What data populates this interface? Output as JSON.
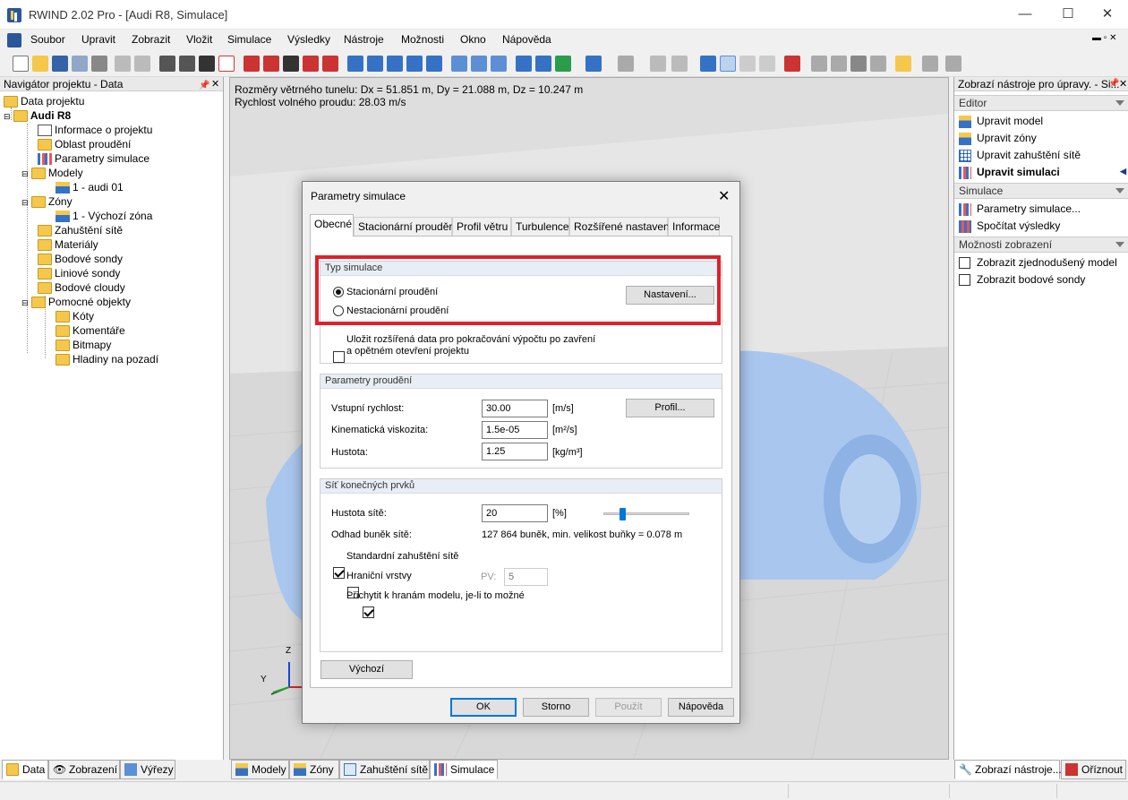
{
  "window": {
    "title": "RWIND 2.02 Pro - [Audi R8, Simulace]"
  },
  "menu": [
    "Soubor",
    "Upravit",
    "Zobrazit",
    "Vložit",
    "Simulace",
    "Výsledky",
    "Nástroje",
    "Možnosti",
    "Okno",
    "Nápověda"
  ],
  "navigator": {
    "title": "Navigátor projektu - Data",
    "items": [
      "Data projektu",
      "Audi R8",
      "Informace o projektu",
      "Oblast proudění",
      "Parametry simulace",
      "Modely",
      "1 - audi 01",
      "Zóny",
      "1 - Výchozí zóna",
      "Zahuštění sítě",
      "Materiály",
      "Bodové sondy",
      "Liniové sondy",
      "Bodové cloudy",
      "Pomocné objekty",
      "Kóty",
      "Komentáře",
      "Bitmapy",
      "Hladiny na pozadí"
    ]
  },
  "viewport": {
    "line1": "Rozměry větrného tunelu: Dx = 51.851 m, Dy = 21.088 m, Dz = 10.247 m",
    "line2": "Rychlost volného proudu: 28.03 m/s",
    "axis_z": "Z",
    "axis_y": "Y"
  },
  "right_panel": {
    "title": "Zobrazí nástroje pro úpravy. - Si...",
    "editor_head": "Editor",
    "editor_items": [
      "Upravit model",
      "Upravit zóny",
      "Upravit zahuštění sítě",
      "Upravit simulaci"
    ],
    "sim_head": "Simulace",
    "sim_items": [
      "Parametry simulace...",
      "Spočítat výsledky"
    ],
    "display_head": "Možnosti zobrazení",
    "display_items": [
      "Zobrazit zjednodušený model",
      "Zobrazit bodové sondy"
    ]
  },
  "bottom_tabs_left": [
    "Data",
    "Zobrazení",
    "Výřezy"
  ],
  "bottom_tabs_mid": [
    "Modely",
    "Zóny",
    "Zahuštění sítě",
    "Simulace"
  ],
  "bottom_tabs_right": [
    "Zobrazí nástroje...",
    "Oříznout"
  ],
  "dialog": {
    "title": "Parametry simulace",
    "close": "✕",
    "tabs": [
      "Obecné",
      "Stacionární proudění",
      "Profil větru",
      "Turbulence",
      "Rozšířené nastavení",
      "Informace"
    ],
    "type_group": "Typ simulace",
    "radio_stationary": "Stacionární proudění",
    "radio_nonstationary": "Nestacionární proudění",
    "settings_button": "Nastavení...",
    "save_extended_1": "Uložit rozšířená data pro pokračování výpočtu po zavření",
    "save_extended_2": "a opětném otevření projektu",
    "flow_group": "Parametry proudění",
    "inlet_label": "Vstupní rychlost:",
    "inlet_value": "30.00",
    "inlet_unit": "[m/s]",
    "profile_button": "Profil...",
    "visc_label": "Kinematická viskozita:",
    "visc_value": "1.5e-05",
    "visc_unit": "[m²/s]",
    "density_label": "Hustota:",
    "density_value": "1.25",
    "density_unit": "[kg/m³]",
    "mesh_group": "Síť konečných prvků",
    "mesh_density_label": "Hustota sítě:",
    "mesh_density_value": "20",
    "mesh_density_unit": "[%]",
    "mesh_density_level": 0.2,
    "cells_label": "Odhad buněk sítě:",
    "cells_value": "127 864 buněk, min. velikost buňky = 0.078 m",
    "std_refine": "Standardní zahuštění sítě",
    "boundary_layers": "Hraniční vrstvy",
    "pv_label": "PV:",
    "pv_value": "5",
    "snap_edges": "Přichytit k hranám modelu, je-li to možné",
    "default_button": "Výchozí",
    "ok": "OK",
    "cancel": "Storno",
    "apply": "Použít",
    "help": "Nápověda"
  }
}
